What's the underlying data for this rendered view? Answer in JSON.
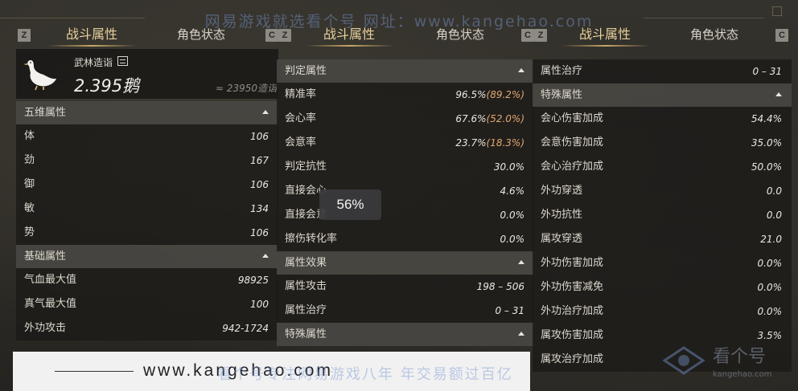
{
  "watermark": {
    "top_text": "网易游戏就选看个号  网址：www.kangehao.com",
    "footer_overlay": "看个号专注网易游戏八年  年交易额过百亿",
    "logo_text": "看个号",
    "logo_sub": "kangehao.com"
  },
  "footer": {
    "url": "www.kangehao.com"
  },
  "tooltip": {
    "text": "56%"
  },
  "panels": [
    {
      "tab_key_left": "Z",
      "tab_key_right": "C",
      "tabs": {
        "active": "战斗属性",
        "inactive": "角色状态"
      },
      "player": {
        "guild_label": "武林造诣",
        "goose_amount": "2.395鹅",
        "goose_sub": "≈ 23950造诣"
      },
      "sections": [
        {
          "title": "五维属性",
          "rows": [
            {
              "label": "体",
              "value": "106"
            },
            {
              "label": "劲",
              "value": "167"
            },
            {
              "label": "御",
              "value": "106"
            },
            {
              "label": "敏",
              "value": "134"
            },
            {
              "label": "势",
              "value": "106"
            }
          ]
        },
        {
          "title": "基础属性",
          "rows": [
            {
              "label": "气血最大值",
              "value": "98925"
            },
            {
              "label": "真气最大值",
              "value": "100"
            },
            {
              "label": "外功攻击",
              "value": "942-1724"
            }
          ]
        }
      ]
    },
    {
      "tab_key_left": "Z",
      "tab_key_right": "C",
      "tabs": {
        "active": "战斗属性",
        "inactive": "角色状态"
      },
      "sections": [
        {
          "title": "判定属性",
          "rows": [
            {
              "label": "精准率",
              "value": "96.5%",
              "extra": "(89.2%)"
            },
            {
              "label": "会心率",
              "value": "67.6%",
              "extra": "(52.0%)"
            },
            {
              "label": "会意率",
              "value": "23.7%",
              "extra": "(18.3%)"
            },
            {
              "label": "判定抗性",
              "value": "30.0%"
            },
            {
              "label": "直接会心",
              "value": "4.6%"
            },
            {
              "label": "直接会意",
              "value": "0.0%"
            },
            {
              "label": "擦伤转化率",
              "value": "0.0%"
            }
          ]
        },
        {
          "title": "属性效果",
          "rows": [
            {
              "label": "属性攻击",
              "value": "198 – 506"
            },
            {
              "label": "属性治疗",
              "value": "0 – 31"
            }
          ]
        },
        {
          "title": "特殊属性",
          "rows": []
        }
      ]
    },
    {
      "tab_key_left": "Z",
      "tab_key_right": "C",
      "tabs": {
        "active": "战斗属性",
        "inactive": "角色状态"
      },
      "sections": [
        {
          "title": "",
          "rows": [
            {
              "label": "属性治疗",
              "value": "0 – 31"
            }
          ]
        },
        {
          "title": "特殊属性",
          "rows": [
            {
              "label": "会心伤害加成",
              "value": "54.4%"
            },
            {
              "label": "会意伤害加成",
              "value": "35.0%"
            },
            {
              "label": "会心治疗加成",
              "value": "50.0%"
            },
            {
              "label": "外功穿透",
              "value": "0.0"
            },
            {
              "label": "外功抗性",
              "value": "0.0"
            },
            {
              "label": "属攻穿透",
              "value": "21.0"
            },
            {
              "label": "外功伤害加成",
              "value": "0.0%"
            },
            {
              "label": "外功伤害减免",
              "value": "0.0%"
            },
            {
              "label": "外功治疗加成",
              "value": "0.0%"
            },
            {
              "label": "属攻伤害加成",
              "value": "3.5%"
            },
            {
              "label": "属攻治疗加成",
              "value": ""
            }
          ]
        }
      ]
    }
  ]
}
